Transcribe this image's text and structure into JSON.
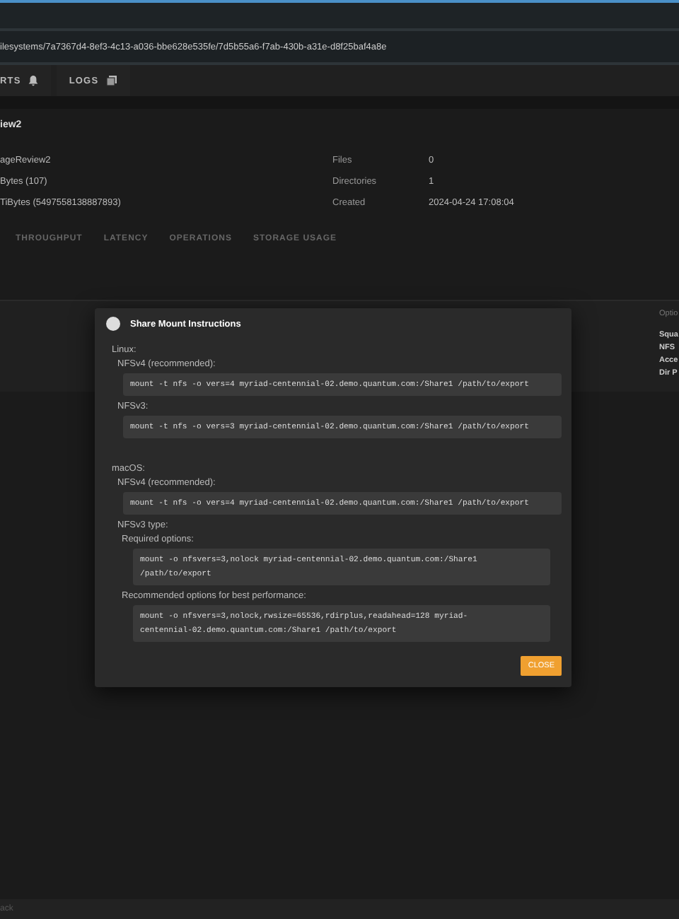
{
  "url": "ilesystems/7a7367d4-8ef3-4c13-a036-bbe628e535fe/7d5b55a6-f7ab-430b-a31e-d8f25baf4a8e",
  "tabs": [
    {
      "label": "RTS",
      "kind": "bell"
    },
    {
      "label": "LOGS",
      "kind": "pages"
    }
  ],
  "page_title": "iew2",
  "details_left": [
    "ageReview2",
    "Bytes (107)",
    "TiBytes (5497558138887893)"
  ],
  "details_right": [
    {
      "label": "Files",
      "value": "0"
    },
    {
      "label": "Directories",
      "value": "1"
    },
    {
      "label": "Created",
      "value": "2024-04-24 17:08:04"
    }
  ],
  "chart_tabs": [
    "THROUGHPUT",
    "LATENCY",
    "OPERATIONS",
    "STORAGE USAGE"
  ],
  "side_panel": {
    "title": "Optio",
    "items": [
      "Squa",
      "NFS",
      "Acce",
      "Dir P"
    ]
  },
  "modal": {
    "title": "Share Mount Instructions",
    "sections": [
      {
        "heading": "Linux:",
        "blocks": [
          {
            "label": "NFSv4 (recommended):",
            "command": "mount -t nfs -o vers=4 myriad-centennial-02.demo.quantum.com:/Share1 /path/to/export"
          },
          {
            "label": "NFSv3:",
            "command": "mount -t nfs -o vers=3 myriad-centennial-02.demo.quantum.com:/Share1 /path/to/export"
          }
        ]
      },
      {
        "heading": "macOS:",
        "blocks": [
          {
            "label": "NFSv4 (recommended):",
            "command": "mount -t nfs -o vers=4 myriad-centennial-02.demo.quantum.com:/Share1 /path/to/export"
          },
          {
            "label": "NFSv3 type:",
            "subs": [
              {
                "label": "Required options:",
                "command": "mount -o nfsvers=3,nolock myriad-centennial-02.demo.quantum.com:/Share1 /path/to/export"
              },
              {
                "label": "Recommended options for best performance:",
                "command": "mount -o nfsvers=3,nolock,rwsize=65536,rdirplus,readahead=128 myriad-centennial-02.demo.quantum.com:/Share1 /path/to/export"
              }
            ]
          }
        ]
      }
    ],
    "close": "CLOSE"
  },
  "status_bar": "ack"
}
